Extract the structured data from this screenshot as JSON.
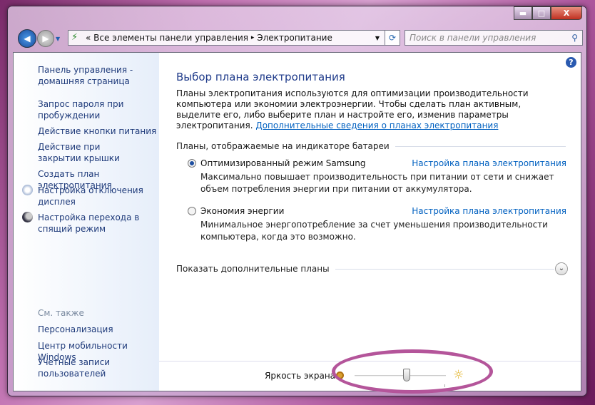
{
  "window": {
    "minimize": "▬",
    "maximize": "□",
    "close": "X"
  },
  "nav": {
    "back": "◀",
    "forward": "▶",
    "history": "▼"
  },
  "address": {
    "sep1": "«",
    "crumbs": [
      "Все элементы панели управления",
      "Электропитание"
    ],
    "sep2": "▸",
    "dropdown": "▼",
    "refresh": "⟳"
  },
  "search": {
    "placeholder": "Поиск в панели управления",
    "icon": "⚲"
  },
  "help": "?",
  "sidebar": {
    "items": [
      "Панель управления - домашняя страница",
      "Запрос пароля при пробуждении",
      "Действие кнопки питания",
      "Действие при закрытии крышки",
      "Создать план электропитания",
      "Настройка отключения дисплея",
      "Настройка перехода в спящий режим"
    ],
    "see_also": "См. также",
    "see_also_items": [
      "Персонализация",
      "Центр мобильности Windows",
      "Учетные записи пользователей"
    ]
  },
  "main": {
    "title": "Выбор плана электропитания",
    "intro": "Планы электропитания используются для оптимизации производительности компьютера или экономии электроэнергии. Чтобы сделать план активным, выделите его, либо выберите план и настройте его, изменив параметры электропитания.",
    "intro_link": "Дополнительные сведения о планах электропитания",
    "section": "Планы, отображаемые на индикаторе батареи",
    "plans": [
      {
        "name": "Оптимизированный режим Samsung",
        "config": "Настройка плана электропитания",
        "desc": "Максимально повышает производительность при питании от сети и снижает объем потребления энергии при питании от аккумулятора.",
        "selected": true
      },
      {
        "name": "Экономия энергии",
        "config": "Настройка плана электропитания",
        "desc": "Минимальное энергопотребление за счет уменьшения производительности компьютера, когда это возможно.",
        "selected": false
      }
    ],
    "more_plans": "Показать дополнительные планы",
    "expand": "⌄"
  },
  "brightness": {
    "label": "Яркость экрана:",
    "value_percent": 57,
    "sun": "☼"
  },
  "colors": {
    "link": "#0060c0",
    "title": "#1e3a8a",
    "highlight": "#b4559a"
  }
}
